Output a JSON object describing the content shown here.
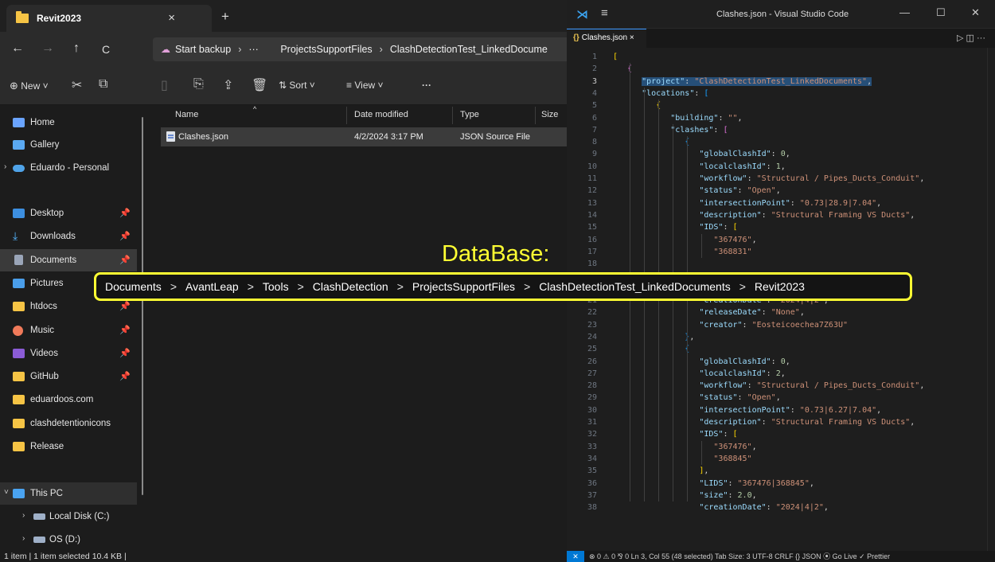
{
  "explorer": {
    "tab_title": "Revit2023",
    "tab_close": "×",
    "tab_new": "+",
    "nav": {
      "back": "←",
      "forward": "→",
      "up": "↑",
      "refresh": "C"
    },
    "breadcrumb": [
      "Start backup",
      "···",
      "ProjectsSupportFiles",
      "ClashDetectionTest_LinkedDocume"
    ],
    "toolbar": {
      "new": "New",
      "sort": "Sort",
      "view": "View",
      "more": "···"
    },
    "sidebar": [
      {
        "label": "Home",
        "icon": "home-icon",
        "color": "#6aa4ff"
      },
      {
        "label": "Gallery",
        "icon": "gallery-icon",
        "color": "#5aa9f2"
      },
      {
        "label": "Eduardo - Personal",
        "icon": "cloud-icon",
        "color": "#4fa3e8"
      },
      {
        "label": "Desktop",
        "icon": "desktop-icon",
        "color": "#3d8fe0"
      },
      {
        "label": "Downloads",
        "icon": "download-icon",
        "color": "#55b6ff"
      },
      {
        "label": "Documents",
        "icon": "documents-icon",
        "color": "#9aa5b8"
      },
      {
        "label": "Pictures",
        "icon": "pictures-icon",
        "color": "#4a9eea"
      },
      {
        "label": "htdocs",
        "icon": "folder-icon",
        "color": "#f6c445"
      },
      {
        "label": "Music",
        "icon": "music-icon",
        "color": "#f07a5a"
      },
      {
        "label": "Videos",
        "icon": "videos-icon",
        "color": "#8b5cd6"
      },
      {
        "label": "GitHub",
        "icon": "folder-icon",
        "color": "#f6c445"
      },
      {
        "label": "eduardoos.com",
        "icon": "folder-icon",
        "color": "#f6c445"
      },
      {
        "label": "clashdetentionicons",
        "icon": "folder-icon",
        "color": "#f6c445"
      },
      {
        "label": "Release",
        "icon": "folder-icon",
        "color": "#f6c445"
      },
      {
        "label": "This PC",
        "icon": "pc-icon",
        "color": "#4aa3f0"
      },
      {
        "label": "Local Disk (C:)",
        "icon": "disk-icon",
        "color": "#9fb0c8"
      },
      {
        "label": "OS (D:)",
        "icon": "disk-icon",
        "color": "#9fb0c8"
      }
    ],
    "columns": {
      "name": "Name",
      "date": "Date modified",
      "type": "Type",
      "size": "Size"
    },
    "files": [
      {
        "name": "Clashes.json",
        "date": "4/2/2024 3:17 PM",
        "type": "JSON Source File"
      }
    ],
    "status": "1 item  |  1 item selected  10.4 KB  |"
  },
  "vscode": {
    "window_title": "Clashes.json - Visual Studio Code",
    "tab_label": "Clashes.json",
    "tab_icon": "{}",
    "tab_close": "×",
    "actions": "▷  ◫  ···",
    "status": "⊗ 0 ⚠ 0   ⅋ 0     Ln 3, Col 55 (48 selected)   Tab Size: 3   UTF-8   CRLF   {} JSON   ⦿ Go Live   ✓ Prettier",
    "line_numbers": [
      "1",
      "2",
      "3",
      "4",
      "5",
      "6",
      "7",
      "8",
      "9",
      "10",
      "11",
      "12",
      "13",
      "14",
      "15",
      "16",
      "17",
      "18",
      "19",
      "20",
      "21",
      "22",
      "23",
      "24",
      "25",
      "26",
      "27",
      "28",
      "29",
      "30",
      "31",
      "32",
      "33",
      "34",
      "35",
      "36",
      "37",
      "38"
    ]
  },
  "overlay": {
    "label": "DataBase:",
    "path": [
      "Documents",
      "AvantLeap",
      "Tools",
      "ClashDetection",
      "ProjectsSupportFiles",
      "ClashDetectionTest_LinkedDocuments",
      "Revit2023"
    ],
    "separator": ">"
  },
  "code": {
    "project_key": "\"project\"",
    "project_val": "\"ClashDetectionTest_LinkedDocuments\"",
    "locations_key": "\"locations\"",
    "building_key": "\"building\"",
    "building_val": "\"\"",
    "clashes_key": "\"clashes\"",
    "gid_key": "\"globalClashId\"",
    "gid_val": "0",
    "lid_key": "\"localclashId\"",
    "lid_val_1": "1",
    "lid_val_2": "2",
    "wf_key": "\"workflow\"",
    "wf_val": "\"Structural / Pipes_Ducts_Conduit\"",
    "st_key": "\"status\"",
    "st_val": "\"Open\"",
    "ip_key": "\"intersectionPoint\"",
    "ip_val_1": "\"0.73|28.9|7.04\"",
    "ip_val_2": "\"0.73|6.27|7.04\"",
    "desc_key": "\"description\"",
    "desc_val": "\"Structural Framing VS Ducts\"",
    "ids_key": "\"IDS\"",
    "id_a": "\"367476\"",
    "id_b_1": "\"368831\"",
    "id_b_2": "\"368845\"",
    "size_key": "\"size\"",
    "size_val": "2.0",
    "cd_key": "\"creationDate\"",
    "cd_val": "\"2024|4|2\"",
    "rd_key": "\"releaseDate\"",
    "rd_val": "\"None\"",
    "cr_key": "\"creator\"",
    "cr_val": "\"Eosteicoechea7Z63U\"",
    "lids_key": "\"LIDS\"",
    "lids_val": "\"367476|368845\""
  }
}
